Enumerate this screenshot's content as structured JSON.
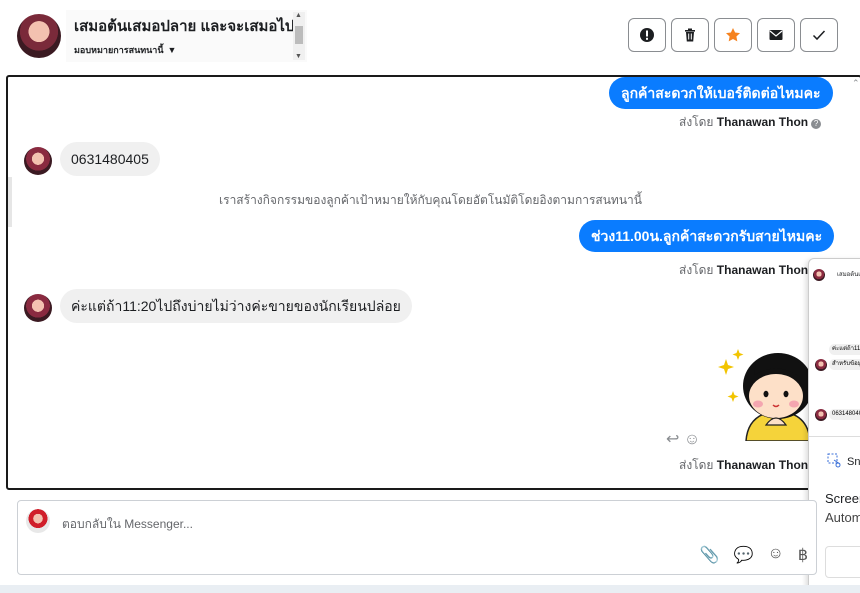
{
  "header": {
    "title": "เสมอต้นเสมอปลาย และจะเสมอไป",
    "assignment_label": "มอบหมายการสนทนานี้",
    "actions": [
      {
        "name": "report-icon",
        "label": "!"
      },
      {
        "name": "trash-icon",
        "label": ""
      },
      {
        "name": "star-icon",
        "label": ""
      },
      {
        "name": "envelope-icon",
        "label": ""
      },
      {
        "name": "check-icon",
        "label": ""
      }
    ],
    "star_color": "#f5821f"
  },
  "messages": {
    "out1": "ลูกค้าสะดวกให้เบอร์ติดต่อไหมคะ",
    "sent_by_prefix": "ส่งโดย",
    "agent_name": "Thanawan Thon",
    "in1": "0631480405",
    "system": "เราสร้างกิจกรรมของลูกค้าเป้าหมายให้กับคุณโดยอัตโนมัติโดยอิงตามการสนทนานี้",
    "out2": "ช่วง11.00น.ลูกค้าสะดวกรับสายไหมคะ",
    "in2": "ค่ะแต่ถ้า11:20ไปถึงบ่ายไม่ว่างค่ะขายของนักเรียนปล่อย"
  },
  "popup": {
    "mini_title": "เสมอต้นเสมอปลาย",
    "mini_b1": "ค่ะแต่ถ้า11:20",
    "mini_b2": "สำหรับข้อมูล",
    "mini_b3": "0631480405",
    "snip_label": "Sn",
    "screen_title": "Screen",
    "screen_sub": "Autom"
  },
  "composer": {
    "placeholder": "ตอบกลับใน Messenger..."
  },
  "colors": {
    "accent": "#0a7cff",
    "incoming_bubble": "#f0f0f0"
  }
}
